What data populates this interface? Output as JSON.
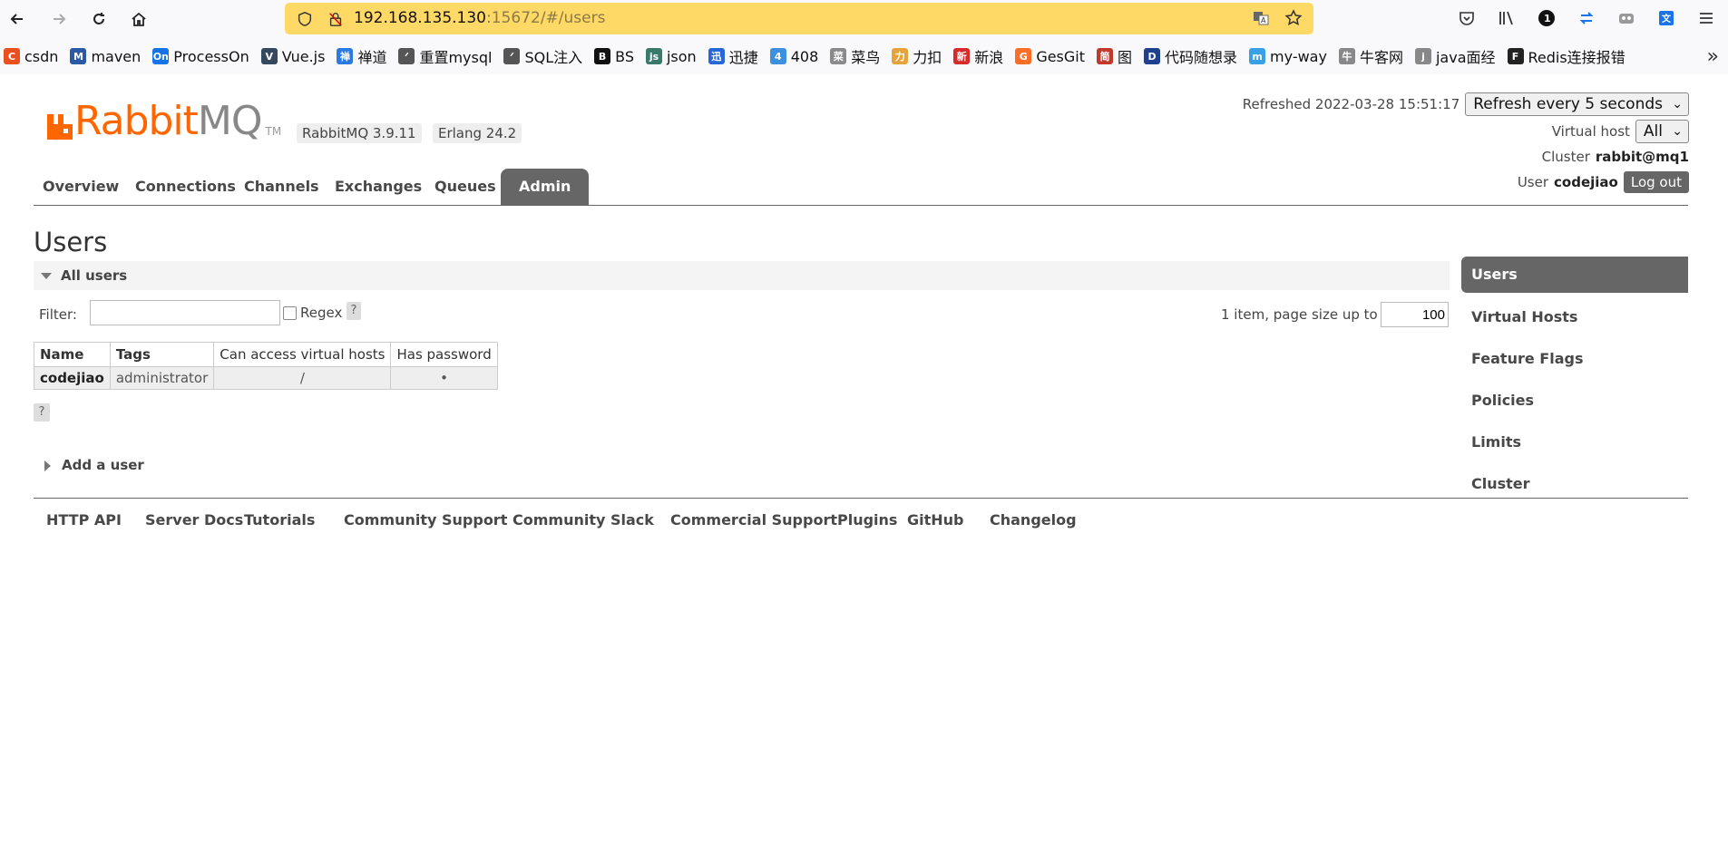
{
  "browser": {
    "url_host": "192.168.135.130",
    "url_rest": ":15672/#/users",
    "bookmarks": [
      {
        "label": "csdn",
        "color": "#e8501f",
        "glyph": "C"
      },
      {
        "label": "maven",
        "color": "#2b59a5",
        "glyph": "M"
      },
      {
        "label": "ProcessOn",
        "color": "#1673e6",
        "glyph": "On"
      },
      {
        "label": "Vue.js",
        "color": "#34495e",
        "glyph": "V"
      },
      {
        "label": "禅道",
        "color": "#2a7ae2",
        "glyph": "禅"
      },
      {
        "label": "重置mysql",
        "color": "#555555",
        "glyph": "ᐟ"
      },
      {
        "label": "SQL注入",
        "color": "#555555",
        "glyph": "ᐟ"
      },
      {
        "label": "BS",
        "color": "#111111",
        "glyph": "B"
      },
      {
        "label": "json",
        "color": "#3a7a6a",
        "glyph": "js"
      },
      {
        "label": "迅捷",
        "color": "#2867d8",
        "glyph": "迅"
      },
      {
        "label": "408",
        "color": "#3d8fe0",
        "glyph": "4"
      },
      {
        "label": "菜鸟",
        "color": "#8a8a8a",
        "glyph": "菜"
      },
      {
        "label": "力扣",
        "color": "#e7a33b",
        "glyph": "力"
      },
      {
        "label": "新浪",
        "color": "#d52b2b",
        "glyph": "新"
      },
      {
        "label": "GesGit",
        "color": "#fc6d26",
        "glyph": "G"
      },
      {
        "label": "图",
        "color": "#c0392b",
        "glyph": "简"
      },
      {
        "label": "代码随想录",
        "color": "#1f3f8f",
        "glyph": "D"
      },
      {
        "label": "my-way",
        "color": "#3aa0e6",
        "glyph": "m"
      },
      {
        "label": "牛客网",
        "color": "#888888",
        "glyph": "牛"
      },
      {
        "label": "java面经",
        "color": "#888888",
        "glyph": "j"
      },
      {
        "label": "Redis连接报错",
        "color": "#222222",
        "glyph": "F"
      }
    ]
  },
  "app": {
    "logo_rabbit": "Rabbit",
    "logo_mq": "MQ",
    "logo_tm": "TM",
    "rabbitmq_version": "RabbitMQ 3.9.11",
    "erlang_version": "Erlang 24.2",
    "refreshed_label": "Refreshed 2022-03-28 15:51:17",
    "refresh_select": "Refresh every 5 seconds",
    "vhost_label": "Virtual host",
    "vhost_select": "All",
    "cluster_label": "Cluster",
    "cluster_name": "rabbit@mq1",
    "user_label": "User",
    "user_name": "codejiao",
    "logout_label": "Log out",
    "accent_color": "#ff6600"
  },
  "tabs": [
    "Overview",
    "Connections",
    "Channels",
    "Exchanges",
    "Queues",
    "Admin"
  ],
  "main": {
    "title": "Users",
    "section_title": "All users",
    "filter_label": "Filter:",
    "filter_value": "",
    "regex_label": "Regex",
    "help": "?",
    "pagination_label": "1 item, page size up to",
    "page_size": "100",
    "table": {
      "headers": [
        "Name",
        "Tags",
        "Can access virtual hosts",
        "Has password"
      ],
      "rows": [
        [
          "codejiao",
          "administrator",
          "/",
          "•"
        ]
      ]
    },
    "add_user_label": "Add a user"
  },
  "sidebar": [
    "Users",
    "Virtual Hosts",
    "Feature Flags",
    "Policies",
    "Limits",
    "Cluster"
  ],
  "footer": [
    "HTTP API",
    "Server Docs",
    "Tutorials",
    "Community Support",
    "Community Slack",
    "Commercial Support",
    "Plugins",
    "GitHub",
    "Changelog"
  ]
}
